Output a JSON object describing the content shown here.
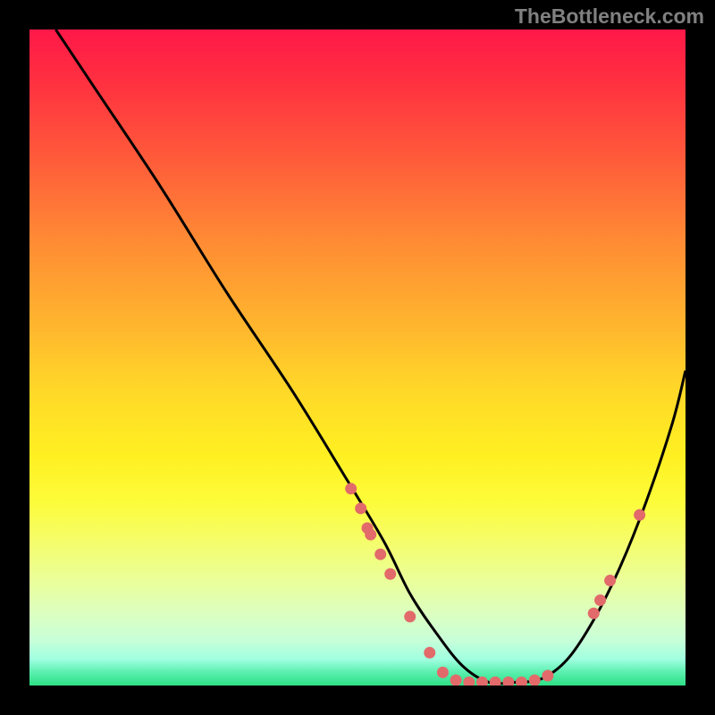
{
  "watermark": "TheBottleneck.com",
  "chart_data": {
    "type": "line",
    "title": "",
    "xlabel": "",
    "ylabel": "",
    "xlim": [
      0,
      100
    ],
    "ylim": [
      0,
      100
    ],
    "curve": {
      "x": [
        4,
        10,
        20,
        30,
        40,
        48,
        54,
        58,
        62,
        66,
        70,
        74,
        78,
        82,
        86,
        90,
        94,
        98,
        100
      ],
      "y": [
        100,
        91,
        76,
        60,
        45,
        32,
        22,
        14,
        8,
        3,
        0.5,
        0.5,
        1,
        4,
        10,
        18,
        28,
        40,
        48
      ]
    },
    "markers": [
      {
        "x": 49,
        "y": 30
      },
      {
        "x": 50.5,
        "y": 27
      },
      {
        "x": 51.5,
        "y": 24
      },
      {
        "x": 52,
        "y": 23
      },
      {
        "x": 53.5,
        "y": 20
      },
      {
        "x": 55,
        "y": 17
      },
      {
        "x": 58,
        "y": 10.5
      },
      {
        "x": 61,
        "y": 5
      },
      {
        "x": 63,
        "y": 2
      },
      {
        "x": 65,
        "y": 0.8
      },
      {
        "x": 67,
        "y": 0.5
      },
      {
        "x": 69,
        "y": 0.5
      },
      {
        "x": 71,
        "y": 0.5
      },
      {
        "x": 73,
        "y": 0.5
      },
      {
        "x": 75,
        "y": 0.5
      },
      {
        "x": 77,
        "y": 0.8
      },
      {
        "x": 79,
        "y": 1.5
      },
      {
        "x": 86,
        "y": 11
      },
      {
        "x": 87,
        "y": 13
      },
      {
        "x": 88.5,
        "y": 16
      },
      {
        "x": 93,
        "y": 26
      }
    ],
    "colors": {
      "curve": "#000000",
      "marker": "#e26a6a"
    }
  }
}
